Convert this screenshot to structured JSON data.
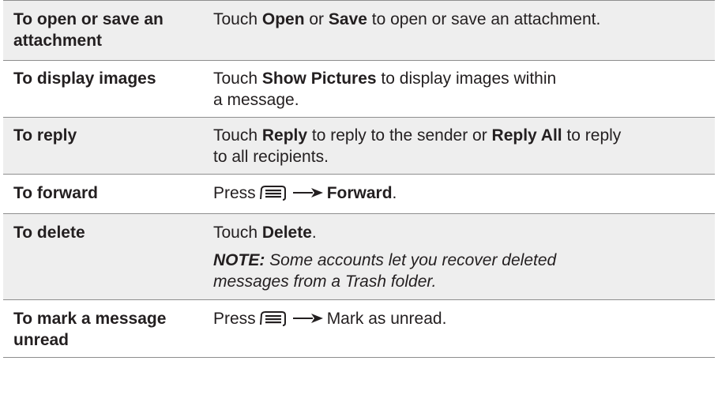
{
  "rows": [
    {
      "action": "To open or save an attachment",
      "desc": {
        "t1": "Touch ",
        "b1": "Open",
        "t2": " or ",
        "b2": "Save",
        "t3": " to open or save an attachment."
      }
    },
    {
      "action": "To display images",
      "desc": {
        "t1": "Touch ",
        "b1": "Show Pictures",
        "t2": " to display images within",
        "t3": "a message."
      }
    },
    {
      "action": "To reply",
      "desc": {
        "t1": "Touch ",
        "b1": "Reply",
        "t2": " to reply to the sender or ",
        "b2": "Reply All",
        "t3": " to reply",
        "t4": "to all recipients."
      }
    },
    {
      "action": "To forward",
      "desc": {
        "t1": "Press",
        "b1": "Forward",
        "t2": "."
      }
    },
    {
      "action": "To delete",
      "desc": {
        "t1": "Touch ",
        "b1": "Delete",
        "t2": "."
      },
      "note": {
        "label": "NOTE:",
        "line1": " Some accounts let you recover deleted",
        "line2": "messages from a Trash folder."
      }
    },
    {
      "action": "To mark a message unread",
      "desc": {
        "t1": "Press",
        "t2": "Mark as unread."
      }
    }
  ],
  "icons": {
    "menu": "menu-key-icon",
    "arrow": "right-arrow-icon"
  }
}
